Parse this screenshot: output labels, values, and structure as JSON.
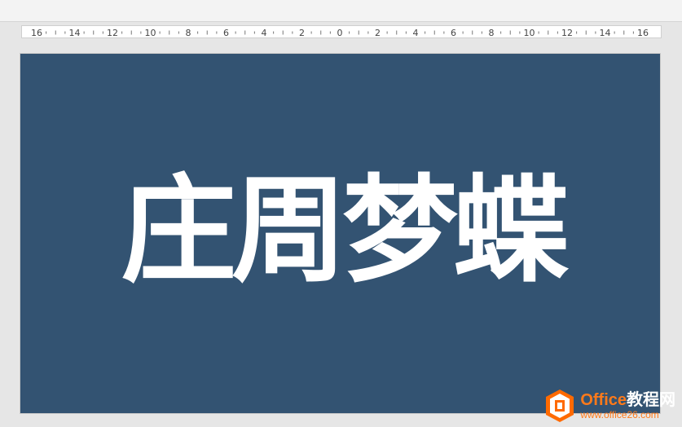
{
  "ruler": {
    "labels": [
      "16",
      "14",
      "12",
      "10",
      "8",
      "6",
      "4",
      "2",
      "0",
      "2",
      "4",
      "6",
      "8",
      "10",
      "12",
      "14",
      "16"
    ]
  },
  "slide": {
    "background_color": "#335372",
    "title": "庄周梦蝶",
    "title_color": "#ffffff"
  },
  "watermark": {
    "brand_prefix": "Office",
    "brand_suffix": "教程网",
    "url": "www.office26.com",
    "icon": "office-logo-icon",
    "accent_color": "#ff7a1a"
  }
}
